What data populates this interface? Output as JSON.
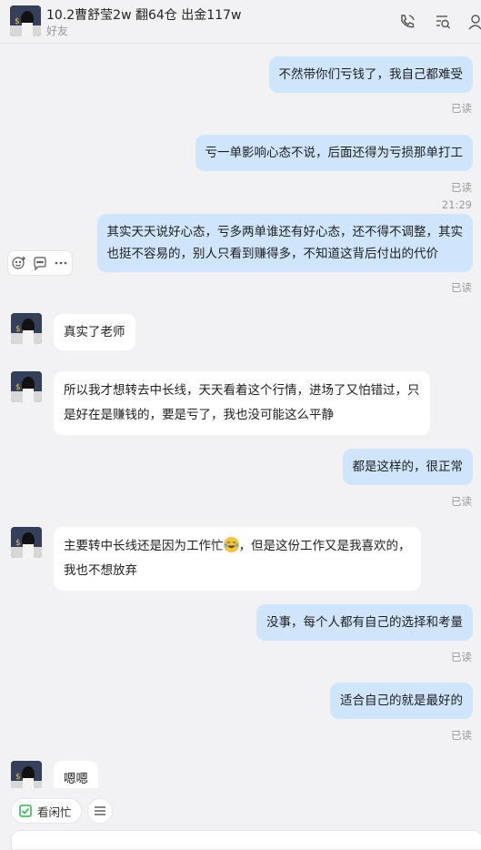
{
  "header": {
    "title": "10.2曹舒莹2w 翻64仓 出金117w",
    "subtitle": "好友",
    "icons": [
      "call-icon",
      "search-chat-icon",
      "profile-icon"
    ]
  },
  "messages": [
    {
      "text": "不然带你们亏钱了，我自己都难受",
      "read": "已读"
    },
    {
      "text": "亏一单影响心态不说，后面还得为亏损那单打工",
      "read": "已读"
    },
    {
      "time": "21:29"
    },
    {
      "line1": "其实天天说好心态，亏多两单谁还有好心态，还不得不调整，其实",
      "line2": "也挺不容易的，别人只看到赚得多，不知道这背后付出的代价",
      "read": "已读"
    },
    {
      "text": "真实了老师"
    },
    {
      "line1": "所以我才想转去中长线，天天看着这个行情，进场了又怕错过，只",
      "line2": "是好在是赚钱的，要是亏了，我也没可能这么平静"
    },
    {
      "text": "都是这样的，很正常",
      "read": "已读"
    },
    {
      "line1a": "主要转中长线还是因为工作忙",
      "emoji": "laughing-tears-emoji",
      "line1b": "，但是这份工作又是我喜欢的，",
      "line2": "我也不想放弃"
    },
    {
      "text": "没事，每个人都有自己的选择和考量",
      "read": "已读"
    },
    {
      "text": "适合自己的就是最好的",
      "read": "已读"
    },
    {
      "text": "嗯嗯"
    }
  ],
  "bottom": {
    "chip_label": "看闲忙"
  },
  "colors": {
    "outgoing_bubble": "#cfe5fb",
    "incoming_bubble": "#ffffff",
    "background": "#f2f2f4",
    "chip_check": "#2bb24c"
  }
}
